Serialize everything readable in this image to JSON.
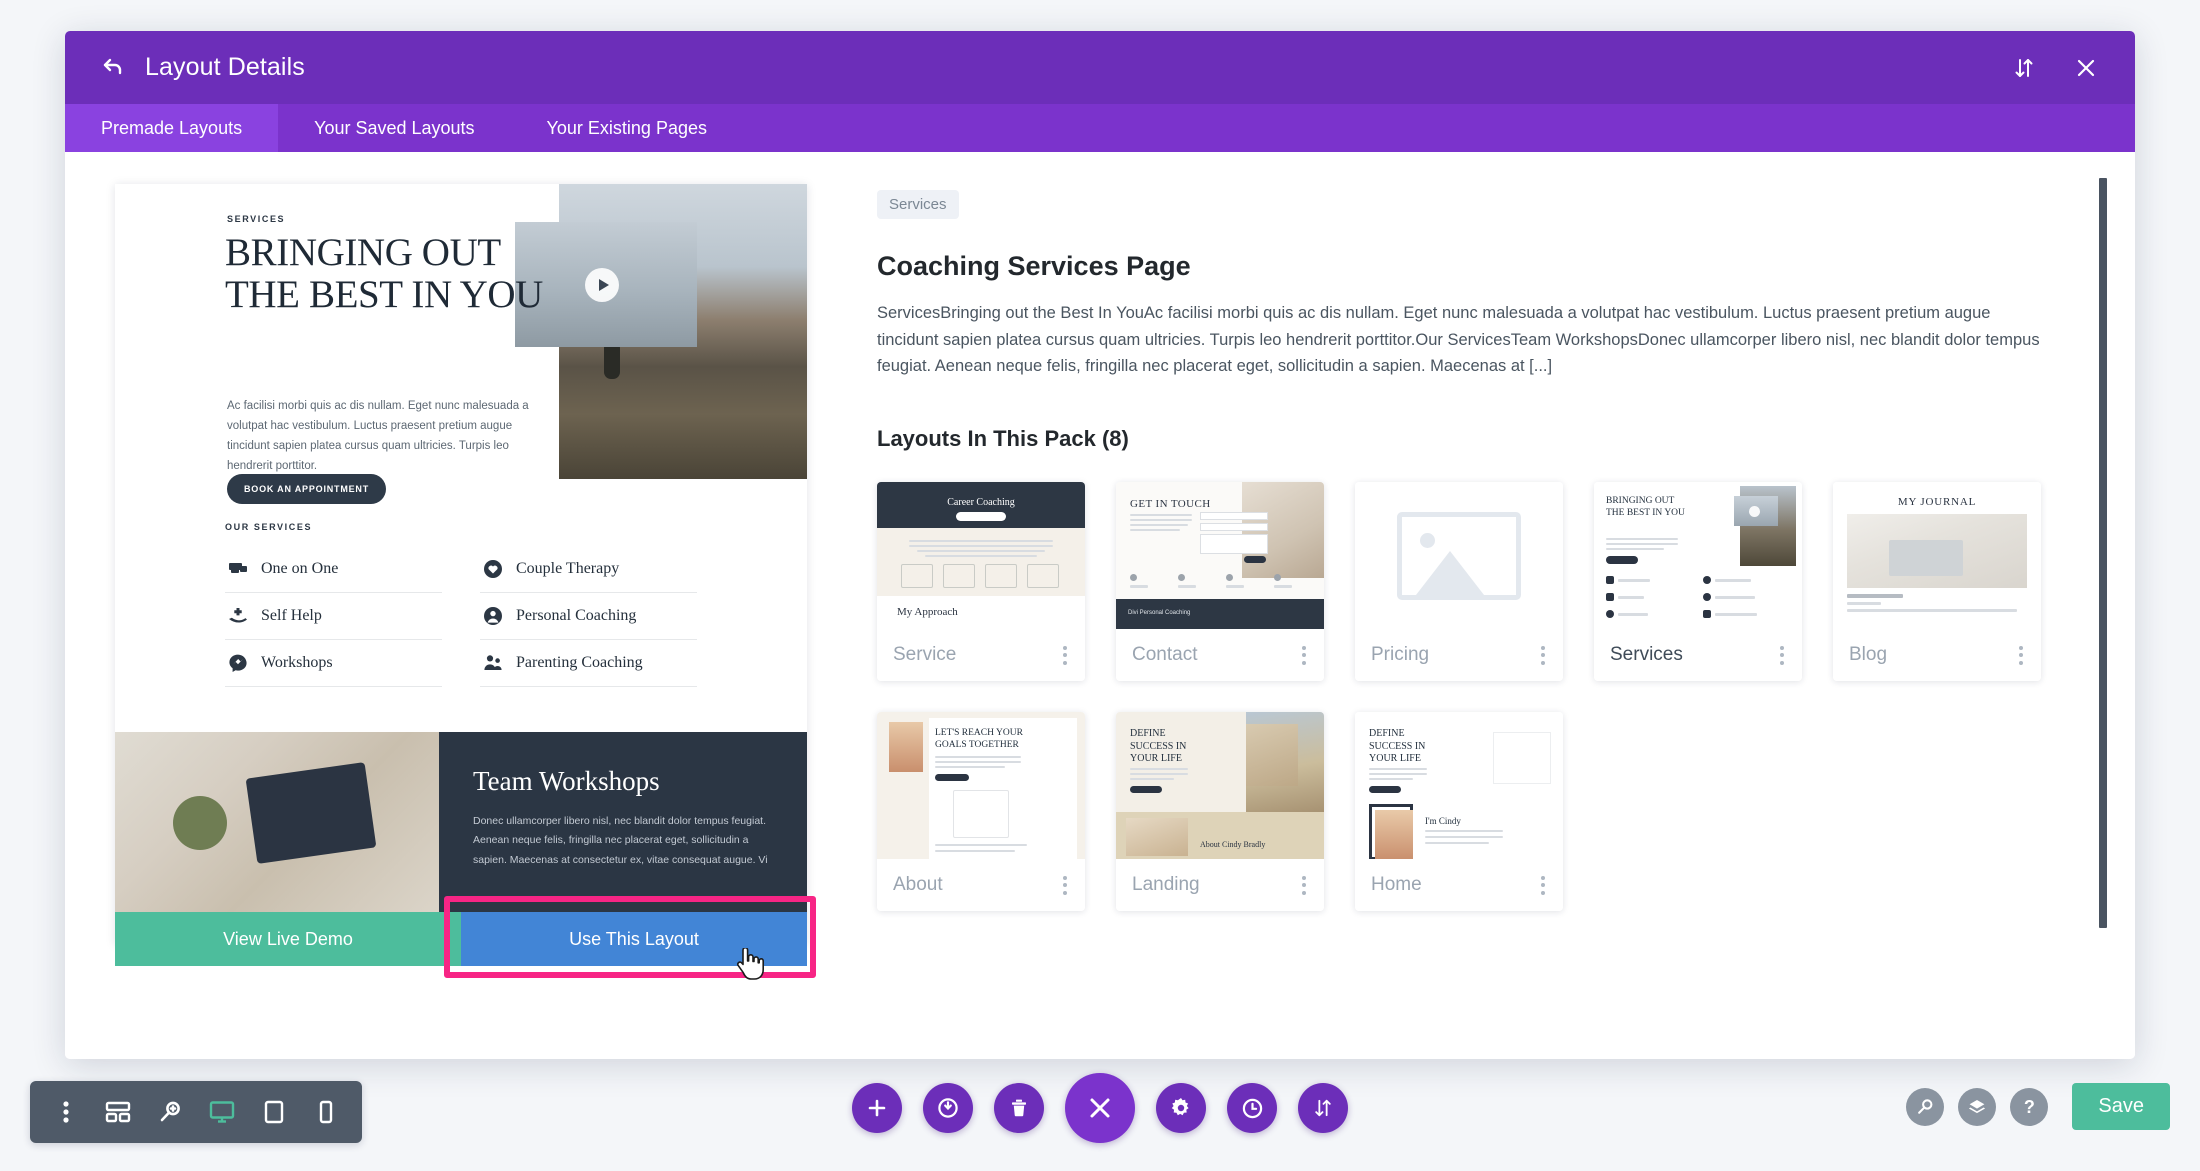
{
  "header": {
    "title": "Layout Details",
    "back_icon": "back-arrow-icon",
    "sort_icon": "sort-updown-icon",
    "close_icon": "close-icon"
  },
  "tabs": [
    {
      "label": "Premade Layouts",
      "active": true
    },
    {
      "label": "Your Saved Layouts",
      "active": false
    },
    {
      "label": "Your Existing Pages",
      "active": false
    }
  ],
  "preview": {
    "eyebrow": "SERVICES",
    "heading": "BRINGING OUT THE BEST IN YOU",
    "paragraph": "Ac facilisi morbi quis ac dis nullam. Eget nunc malesuada a volutpat hac vestibulum. Luctus praesent pretium augue tincidunt sapien platea cursus quam ultricies. Turpis leo hendrerit porttitor.",
    "cta_label": "BOOK AN APPOINTMENT",
    "services_title": "OUR SERVICES",
    "services": [
      {
        "label": "One on One",
        "icon": "handshake-icon"
      },
      {
        "label": "Couple Therapy",
        "icon": "heart-circle-icon"
      },
      {
        "label": "Self Help",
        "icon": "hand-plus-icon"
      },
      {
        "label": "Personal Coaching",
        "icon": "person-circle-icon"
      },
      {
        "label": "Workshops",
        "icon": "chat-bolt-icon"
      },
      {
        "label": "Parenting Coaching",
        "icon": "people-icon"
      }
    ],
    "team_heading": "Team Workshops",
    "team_paragraph": "Donec ullamcorper libero nisl, nec blandit dolor tempus feugiat. Aenean neque felis, fringilla nec placerat eget, sollicitudin a sapien. Maecenas at consectetur ex, vitae consequat augue. Vi",
    "demo_button": "View Live Demo",
    "use_button": "Use This Layout"
  },
  "detail": {
    "badge": "Services",
    "title": "Coaching Services Page",
    "description": "ServicesBringing out the Best In YouAc facilisi morbi quis ac dis nullam. Eget nunc malesuada a volutpat hac vestibulum. Luctus praesent pretium augue tincidunt sapien platea cursus quam ultricies. Turpis leo hendrerit porttitor.Our ServicesTeam WorkshopsDonec ullamcorper libero nisl, nec blandit dolor tempus feugiat. Aenean neque felis, fringilla nec placerat eget, sollicitudin a sapien. Maecenas at [...]",
    "pack_title": "Layouts In This Pack (8)",
    "layouts": [
      {
        "name": "Service",
        "selected": false,
        "thumb": "service"
      },
      {
        "name": "Contact",
        "selected": false,
        "thumb": "contact"
      },
      {
        "name": "Pricing",
        "selected": false,
        "thumb": "placeholder"
      },
      {
        "name": "Services",
        "selected": true,
        "thumb": "services"
      },
      {
        "name": "Blog",
        "selected": false,
        "thumb": "blog"
      },
      {
        "name": "About",
        "selected": false,
        "thumb": "about"
      },
      {
        "name": "Landing",
        "selected": false,
        "thumb": "landing"
      },
      {
        "name": "Home",
        "selected": false,
        "thumb": "home"
      }
    ],
    "thumb_text": {
      "service_title": "Career Coaching",
      "service_sub": "My Approach",
      "contact_title": "GET IN TOUCH",
      "contact_footer": "Divi Personal Coaching",
      "services_title": "BRINGING OUT THE BEST IN YOU",
      "blog_title": "MY JOURNAL",
      "about_title": "LET'S REACH YOUR GOALS TOGETHER",
      "landing_title": "DEFINE SUCCESS IN YOUR LIFE",
      "landing_sub": "About Cindy Bradly",
      "home_title": "DEFINE SUCCESS IN YOUR LIFE",
      "home_sub": "I'm Cindy"
    }
  },
  "toolbar": {
    "left": [
      {
        "icon": "kebab-menu-icon",
        "active": false
      },
      {
        "icon": "wireframe-icon",
        "active": false
      },
      {
        "icon": "zoom-icon",
        "active": false
      },
      {
        "icon": "desktop-icon",
        "active": true
      },
      {
        "icon": "tablet-icon",
        "active": false
      },
      {
        "icon": "phone-icon",
        "active": false
      }
    ],
    "center": [
      {
        "icon": "plus-icon",
        "big": false
      },
      {
        "icon": "power-icon",
        "big": false
      },
      {
        "icon": "trash-icon",
        "big": false
      },
      {
        "icon": "close-icon",
        "big": true
      },
      {
        "icon": "gear-icon",
        "big": false
      },
      {
        "icon": "history-icon",
        "big": false
      },
      {
        "icon": "sort-updown-icon",
        "big": false
      }
    ],
    "right": [
      {
        "icon": "search-icon"
      },
      {
        "icon": "layers-icon"
      },
      {
        "icon": "help-icon"
      }
    ],
    "save_label": "Save"
  },
  "colors": {
    "purple": "#6c2eb9",
    "purple_light": "#8a42e0",
    "green": "#4dbd9c",
    "blue": "#4285d6",
    "pink_highlight": "#f72585",
    "dark_slate": "#2b3644"
  }
}
